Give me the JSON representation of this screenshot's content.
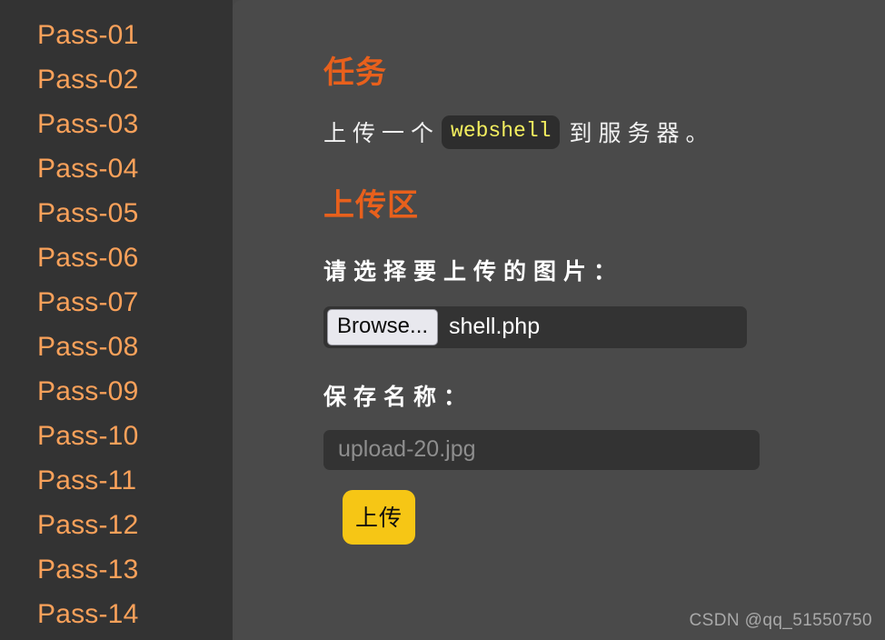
{
  "sidebar": {
    "items": [
      {
        "label": "Pass-01"
      },
      {
        "label": "Pass-02"
      },
      {
        "label": "Pass-03"
      },
      {
        "label": "Pass-04"
      },
      {
        "label": "Pass-05"
      },
      {
        "label": "Pass-06"
      },
      {
        "label": "Pass-07"
      },
      {
        "label": "Pass-08"
      },
      {
        "label": "Pass-09"
      },
      {
        "label": "Pass-10"
      },
      {
        "label": "Pass-11"
      },
      {
        "label": "Pass-12"
      },
      {
        "label": "Pass-13"
      },
      {
        "label": "Pass-14"
      }
    ]
  },
  "main": {
    "task_heading": "任务",
    "task_text_before": "上传一个",
    "task_code": "webshell",
    "task_text_after": "到服务器。",
    "upload_heading": "上传区",
    "file_label": "请选择要上传的图片：",
    "browse_button": "Browse...",
    "selected_file": "shell.php",
    "savename_label": "保存名称：",
    "savename_value": "",
    "savename_placeholder": "upload-20.jpg",
    "submit_button": "上传"
  },
  "watermark": "CSDN @qq_51550750",
  "colors": {
    "sidebar_bg": "#333333",
    "content_bg": "#4a4a4a",
    "link_orange": "#f9a15a",
    "heading_orange": "#e8601c",
    "code_yellow": "#f4ef5f",
    "input_bg": "#333333",
    "button_gold": "#f6c615"
  }
}
